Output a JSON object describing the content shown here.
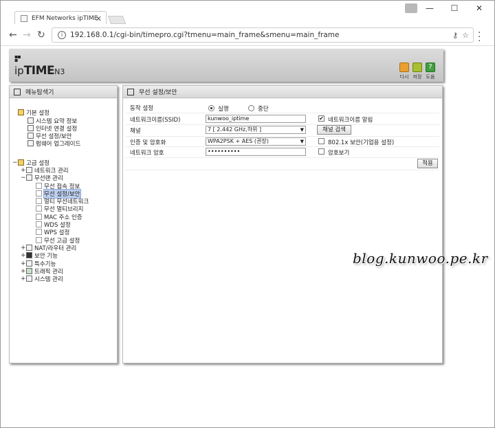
{
  "browser": {
    "tab_title": "EFM Networks ipTIME N",
    "url": "192.168.0.1/cgi-bin/timepro.cgi?tmenu=main_frame&smenu=main_frame",
    "info_icon": "i",
    "window_controls": {
      "minimize": "—",
      "maximize": "☐",
      "close": "✕"
    }
  },
  "header": {
    "logo_prefix": "ip",
    "logo_bold": "TIME",
    "logo_model": "N3",
    "buttons": [
      {
        "label": "다시",
        "icon": "refresh-icon",
        "color": "#e8a030"
      },
      {
        "label": "저장",
        "icon": "save-icon",
        "color": "#a8c030"
      },
      {
        "label": "도움",
        "icon": "help-icon",
        "color": "#40a040"
      }
    ]
  },
  "menu": {
    "title": "메뉴탐색기",
    "basic": {
      "label": "기본 설정",
      "items": [
        "시스템 요약 정보",
        "인터넷 연결 설정",
        "무선 설정/보안",
        "펌웨어 업그레이드"
      ]
    },
    "advanced": {
      "label": "고급 설정",
      "network": "네트워크 관리",
      "wireless": "무선랜 관리",
      "wireless_items": [
        "무선 접속 정보",
        "무선 설정/보안",
        "멀티 무선네트워크",
        "무선 멀티브리지",
        "MAC 주소 인증",
        "WDS 설정",
        "WPS 설정",
        "무선 고급 설정"
      ],
      "wireless_selected": 1,
      "others": [
        "NAT/라우터 관리",
        "보안 기능",
        "특수기능",
        "트래픽 관리",
        "시스템 관리"
      ]
    },
    "expand_plus": "+",
    "expand_minus": "−"
  },
  "main": {
    "title": "무선 설정/보안",
    "rows": {
      "operation_label": "동작 설정",
      "operation_options": [
        "실행",
        "중단"
      ],
      "operation_selected": "실행",
      "ssid_label": "네트워크이름(SSID)",
      "ssid_value": "kunwoo_iptime",
      "ssid_broadcast_label": "네트워크이름 알림",
      "ssid_broadcast_checked": true,
      "channel_label": "채널",
      "channel_value": "7 [ 2.442 GHz,하위 ]",
      "channel_search_button": "채널 검색",
      "auth_label": "인증 및 암호화",
      "auth_value": "WPA2PSK + AES (권장)",
      "dot1x_label": "802.1x 보안(기업용 설정)",
      "dot1x_checked": false,
      "password_label": "네트워크 암호",
      "password_value": "••••••••••",
      "show_password_label": "암호보기",
      "show_password_checked": false,
      "apply_button": "적용"
    }
  },
  "watermark": "blog.kunwoo.pe.kr"
}
